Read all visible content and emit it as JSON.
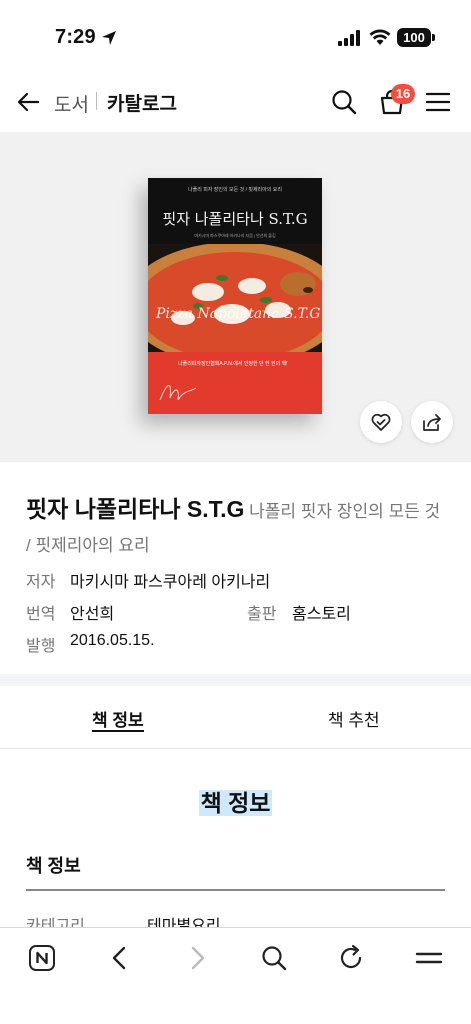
{
  "status_bar": {
    "time": "7:29",
    "battery": "100"
  },
  "header": {
    "breadcrumb_parent": "도서",
    "breadcrumb_current": "카탈로그",
    "cart_count": "16",
    "badge_color": "#f0503c"
  },
  "cover": {
    "subtitle": "나폴리 피자 장인의 모든 것 / 핏제리아의 요리",
    "title": "핏자 나폴리타나 S.T.G",
    "author_line": "마키시마 파스쿠아레 아키나리 지음 | 안선희 옮김",
    "script_text": "Pizza Napoletana S.T.G",
    "red_band_text": "나폴리피자장인협회A.P.N.에서 인정한 단 한 권의 책!",
    "band_color": "#e23a2c"
  },
  "book": {
    "title": "핏자 나폴리타나 S.T.G",
    "subtitle": "나폴리 핏자 장인의 모든 것 / 핏제리아의 요리",
    "author_label": "저자",
    "author": "마키시마 파스쿠아레 아키나리",
    "translator_label": "번역",
    "translator": "안선희",
    "publisher_label": "출판",
    "publisher": "홈스토리",
    "date_label": "발행",
    "date": "2016.05.15."
  },
  "tabs": [
    {
      "label": "책 정보",
      "active": true
    },
    {
      "label": "책 추천",
      "active": false
    }
  ],
  "section": {
    "heading": "책 정보",
    "sub_heading": "책 정보",
    "category_label": "카테고리",
    "category_value": "테마별요리"
  },
  "icons": {
    "back": "arrow-left-icon",
    "search": "search-icon",
    "cart": "shopping-bag-icon",
    "menu": "hamburger-menu-icon",
    "wish": "heart-check-icon",
    "share": "share-icon",
    "bottom": [
      "naver-home-icon",
      "back-chevron-icon",
      "forward-chevron-icon",
      "search-icon",
      "refresh-icon",
      "menu-icon"
    ]
  }
}
